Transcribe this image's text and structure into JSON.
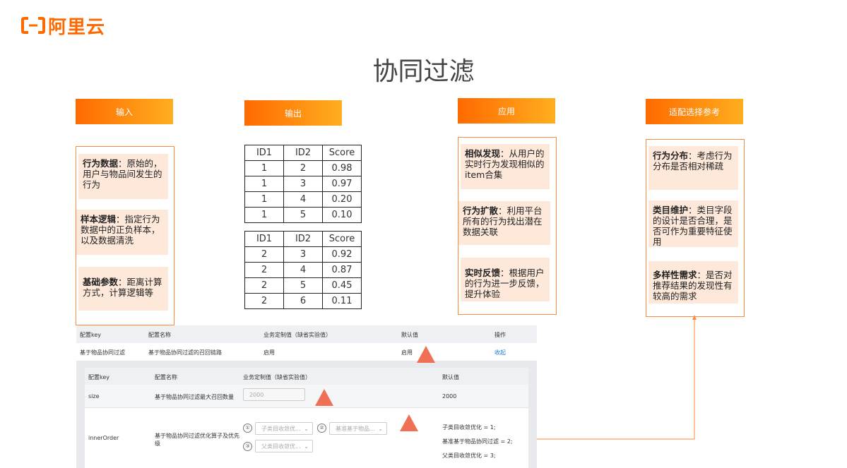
{
  "logo": {
    "text": "阿里云"
  },
  "title": "协同过滤",
  "sections": {
    "input": {
      "header": "输入",
      "cards": [
        {
          "bold": "行为数据",
          "text": "：原始的，用户与物品间发生的行为"
        },
        {
          "bold": "样本逻辑",
          "text": "：指定行为数据中的正负样本，以及数据清洗"
        },
        {
          "bold": "基础参数",
          "text": "：距离计算方式，计算逻辑等"
        }
      ]
    },
    "output": {
      "header": "输出",
      "table1": {
        "headers": [
          "ID1",
          "ID2",
          "Score"
        ],
        "rows": [
          [
            "1",
            "2",
            "0.98"
          ],
          [
            "1",
            "3",
            "0.97"
          ],
          [
            "1",
            "4",
            "0.20"
          ],
          [
            "1",
            "5",
            "0.10"
          ]
        ]
      },
      "table2": {
        "headers": [
          "ID1",
          "ID2",
          "Score"
        ],
        "rows": [
          [
            "2",
            "3",
            "0.92"
          ],
          [
            "2",
            "4",
            "0.87"
          ],
          [
            "2",
            "5",
            "0.45"
          ],
          [
            "2",
            "6",
            "0.11"
          ]
        ]
      }
    },
    "application": {
      "header": "应用",
      "cards": [
        {
          "bold": "相似发现",
          "text": "：从用户的实时行为发现相似的item合集"
        },
        {
          "bold": "行为扩散",
          "text": "：利用平台所有的行为找出潜在数据关联"
        },
        {
          "bold": "实时反馈",
          "text": "：根据用户的行为进一步反馈，提升体验"
        }
      ]
    },
    "reference": {
      "header": "适配选择参考",
      "cards": [
        {
          "bold": "行为分布",
          "text": "：考虑行为分布是否相对稀疏"
        },
        {
          "bold": "类目维护",
          "text": "：类目字段的设计是否合理，是否可作为重要特征使用"
        },
        {
          "bold": "多样性需求",
          "text": "：是否对推荐结果的发现性有较高的需求"
        }
      ]
    }
  },
  "config_outer": {
    "headers": [
      "配置key",
      "配置名称",
      "业务定制值（缺省实验值）",
      "默认值",
      "操作"
    ],
    "row": {
      "key": "基于物品协同过滤",
      "name": "基于物品协同过滤的召回链路",
      "custom": "启用",
      "default": "启用",
      "action": "收起"
    }
  },
  "config_inner": {
    "headers": [
      "配置key",
      "配置名称",
      "业务定制值（缺省实验值）",
      "默认值"
    ],
    "size_row": {
      "key": "size",
      "name": "基于物品协同过滤最大召回数量",
      "placeholder": "2000",
      "default": "2000"
    },
    "order_row": {
      "key": "innerOrder",
      "name": "基于物品协同过滤优化算子及优先级",
      "selects": [
        {
          "num": "①",
          "value": "子类目收敛优..."
        },
        {
          "num": "②",
          "value": "基准基于物品..."
        },
        {
          "num": "③",
          "value": "父类目收敛优..."
        }
      ],
      "defaults": [
        "子类目收敛优化 = 1;",
        "基准基于物品协同过滤 = 2;",
        "父类目收敛优化 = 3;"
      ]
    }
  },
  "colors": {
    "accent": "#ff6a00",
    "card": "#fde8d9",
    "triangle": "#f07055",
    "link": "#1a7bd6"
  }
}
